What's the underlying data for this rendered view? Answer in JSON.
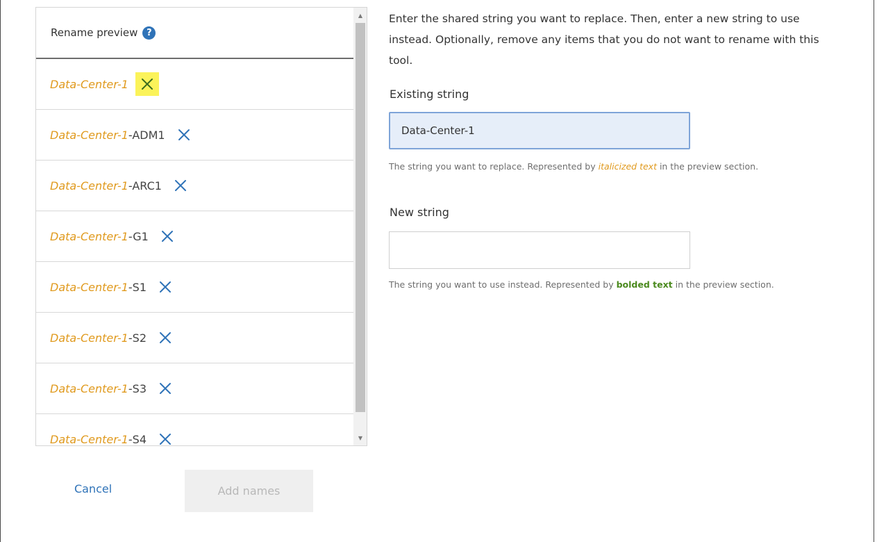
{
  "preview": {
    "header": "Rename preview",
    "help_glyph": "?",
    "items": [
      {
        "old": "Data-Center-1",
        "suffix": ""
      },
      {
        "old": "Data-Center-1",
        "suffix": "-ADM1"
      },
      {
        "old": "Data-Center-1",
        "suffix": "-ARC1"
      },
      {
        "old": "Data-Center-1",
        "suffix": "-G1"
      },
      {
        "old": "Data-Center-1",
        "suffix": "-S1"
      },
      {
        "old": "Data-Center-1",
        "suffix": "-S2"
      },
      {
        "old": "Data-Center-1",
        "suffix": "-S3"
      },
      {
        "old": "Data-Center-1",
        "suffix": "-S4"
      }
    ]
  },
  "form": {
    "instructions": "Enter the shared string you want to replace. Then, enter a new string to use instead. Optionally, remove any items that you do not want to rename with this tool.",
    "existing_label": "Existing string",
    "existing_value": "Data-Center-1",
    "existing_hint_prefix": "The string you want to replace. Represented by ",
    "existing_hint_emph": "italicized text",
    "existing_hint_suffix": " in the preview section.",
    "new_label": "New string",
    "new_value": "",
    "new_hint_prefix": "The string you want to use instead. Represented by ",
    "new_hint_emph": "bolded text",
    "new_hint_suffix": " in the preview section."
  },
  "footer": {
    "cancel_label": "Cancel",
    "add_label": "Add names"
  },
  "colors": {
    "accent": "#2f73b8",
    "italic_highlight": "#e09a1e",
    "bold_highlight": "#4b8a1e",
    "remove_highlight": "#fbf35a"
  }
}
